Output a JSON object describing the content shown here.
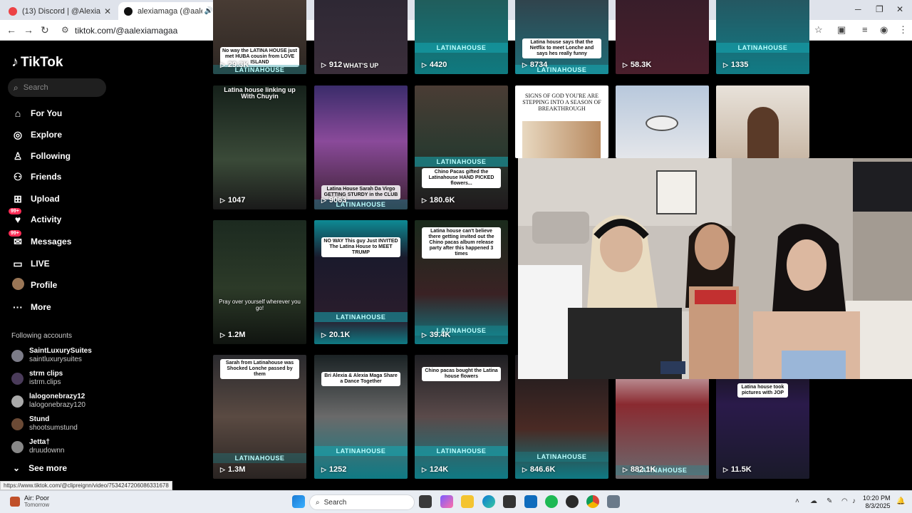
{
  "browser": {
    "tabs": [
      {
        "title": "(13) Discord | @AlexiaMaga",
        "active": false
      },
      {
        "title": "alexiamaga (@aalexiamaga",
        "active": true
      }
    ],
    "url": "tiktok.com/@aalexiamagaa",
    "status_url": "https://www.tiktok.com/@clipreignn/video/7534247206086331678"
  },
  "sidebar": {
    "logo": "TikTok",
    "search_placeholder": "Search",
    "nav": [
      {
        "label": "For You",
        "icon": "home-icon"
      },
      {
        "label": "Explore",
        "icon": "compass-icon"
      },
      {
        "label": "Following",
        "icon": "following-icon"
      },
      {
        "label": "Friends",
        "icon": "friends-icon"
      },
      {
        "label": "Upload",
        "icon": "upload-icon"
      },
      {
        "label": "Activity",
        "icon": "activity-icon",
        "badge": "99+"
      },
      {
        "label": "Messages",
        "icon": "messages-icon",
        "badge": "99+"
      },
      {
        "label": "LIVE",
        "icon": "live-icon"
      },
      {
        "label": "Profile",
        "icon": "avatar"
      },
      {
        "label": "More",
        "icon": "more-icon"
      }
    ],
    "following_title": "Following accounts",
    "accounts": [
      {
        "name": "SaintLuxurySuites",
        "handle": "saintluxurysuites"
      },
      {
        "name": "strm clips",
        "handle": "istrm.clips"
      },
      {
        "name": "lalogonebrazy12",
        "handle": "lalogonebrazy120"
      },
      {
        "name": "Stund",
        "handle": "shootsumstund"
      },
      {
        "name": "Jetta†",
        "handle": "druudownn"
      }
    ],
    "see_more": "See more"
  },
  "videos": {
    "row1": [
      "29.3K",
      "912",
      "4420",
      "8734",
      "58.3K",
      "1335"
    ],
    "row2": [
      "1047",
      "9063",
      "180.6K"
    ],
    "row3": [
      "1.2M",
      "20.1K",
      "39.4K"
    ],
    "row4": [
      "1.3M",
      "1252",
      "124K",
      "846.6K",
      "882.1K",
      "11.5K"
    ],
    "captions": {
      "r1c1": "No way the LATINA HOUSE just met HUBA cousin from LOVE ISLAND",
      "r1c2": "WHAT'S UP",
      "r1c4": "Latina house says that the Netflix to meet Lonche and says hes really funny",
      "r2c1": "Latina house linking up With Chuyin",
      "r2c2": "Latina House Sarah Da Virgo GETTING STURDY in the CLUB",
      "r2c3": "Chino Pacas gifted the Latinahouse HAND PICKED flowers...",
      "r2c4": "SIGNS OF GOD YOU'RE ARE STEPPING INTO A SEASON OF BREAKTHROUGH",
      "r3c1": "Pray over yourself wherever you go!",
      "r3c2": "NO WAY This guy Just INVITED The Latina House to MEET TRUMP",
      "r3c3": "Latina house can't believe there getting invited out the Chino pacas album release party after this happened 3 times",
      "r4c1": "Sarah from Latinahouse was Shocked Lonche passed by them",
      "r4c2": "Bri Alexia & Alexia Maga Share a Dance Together",
      "r4c3": "Chino pacas bought the Latina house flowers",
      "r4c6": "Latina house took pictures with JOP"
    },
    "brand": "LATINAHOUSE"
  },
  "taskbar": {
    "weather": "Air: Poor",
    "weather_sub": "Tomorrow",
    "search": "Search",
    "time": "10:20 PM",
    "date": "8/3/2025"
  }
}
